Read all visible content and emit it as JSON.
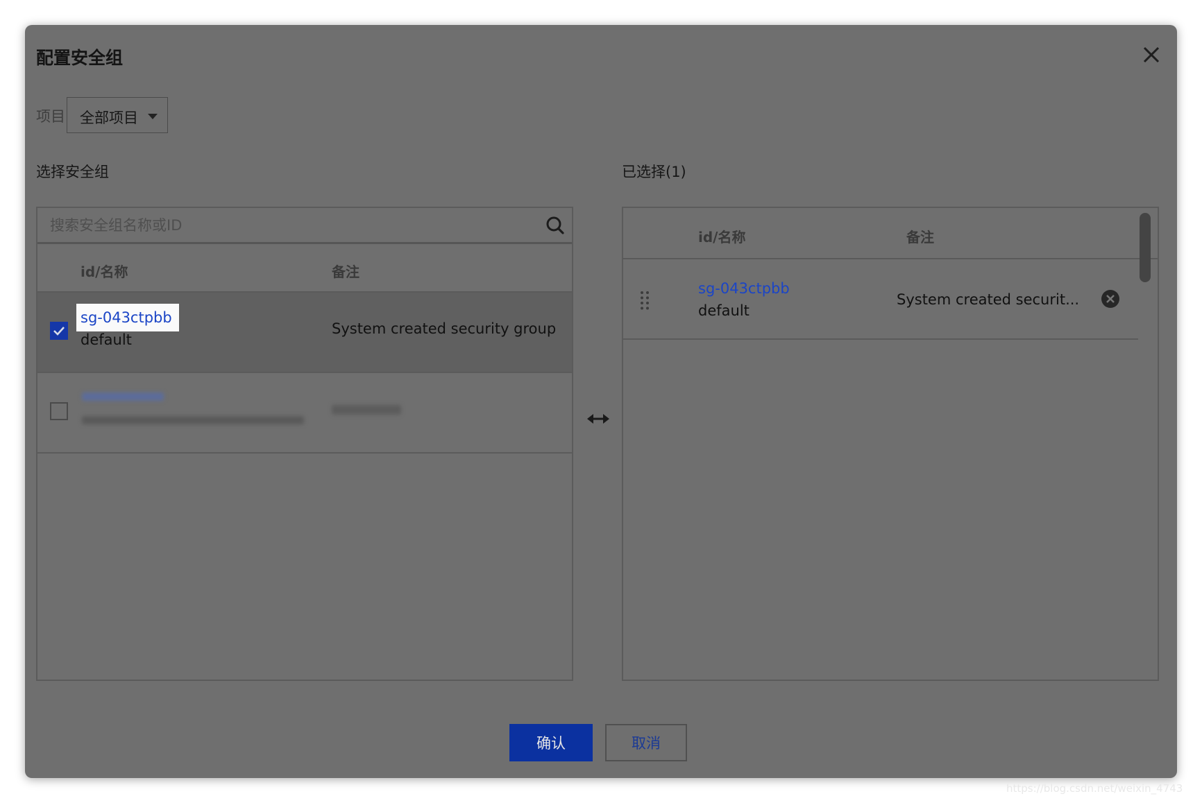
{
  "dialog": {
    "title": "配置安全组",
    "close_icon": "close-icon"
  },
  "project_filter": {
    "label": "项目",
    "selected": "全部项目"
  },
  "left": {
    "section_label": "选择安全组",
    "search_placeholder": "搜索安全组名称或ID",
    "columns": [
      "id/名称",
      "备注"
    ],
    "rows": [
      {
        "checked": true,
        "id": "sg-043ctpbb",
        "name": "default",
        "remark": "System created security group"
      },
      {
        "checked": false,
        "id": "",
        "name": "",
        "remark": ""
      }
    ]
  },
  "transfer_icon": "bidirectional-arrow-icon",
  "right": {
    "section_label": "已选择(1)",
    "columns": [
      "id/名称",
      "备注"
    ],
    "rows": [
      {
        "id": "sg-043ctpbb",
        "name": "default",
        "remark": "System created securit..."
      }
    ]
  },
  "footer": {
    "confirm_label": "确认",
    "cancel_label": "取消"
  },
  "watermark": "https://blog.csdn.net/weixin_4743",
  "colors": {
    "overlay": "#6f6f6f",
    "link": "#1b45c6",
    "primary_button": "#0b31a0",
    "checkbox_checked": "#1537a8"
  }
}
